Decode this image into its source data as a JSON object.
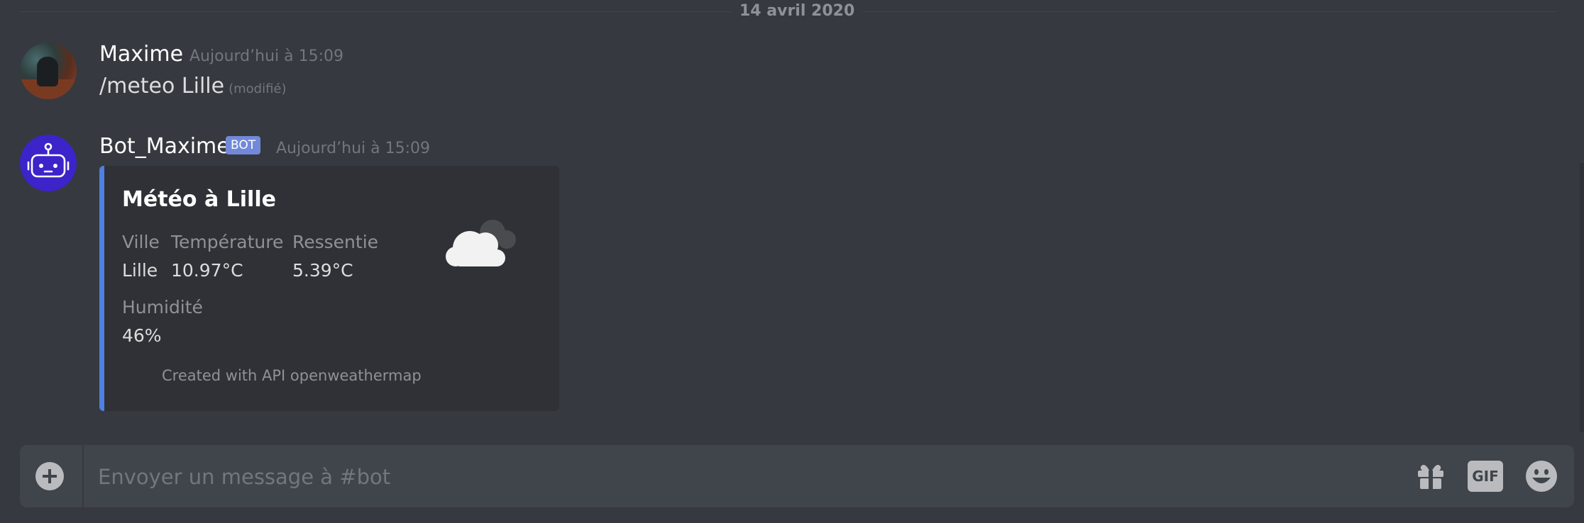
{
  "divider": {
    "date": "14 avril 2020"
  },
  "messages": [
    {
      "author": "Maxime",
      "timestamp": "Aujourd’hui à 15:09",
      "text": "/meteo Lille",
      "edited": "(modifié)"
    },
    {
      "author": "Bot_Maxime",
      "badge": "BOT",
      "timestamp": "Aujourd’hui à 15:09",
      "embed": {
        "accent_color": "#4f80e1",
        "title": "Météo à Lille",
        "fields": [
          {
            "name": "Ville",
            "value": "Lille"
          },
          {
            "name": "Température",
            "value": "10.97°C"
          },
          {
            "name": "Ressentie",
            "value": "5.39°C"
          },
          {
            "name": "Humidité",
            "value": "46%"
          }
        ],
        "footer": "Created with API openweathermap",
        "thumbnail_icon": "cloud-icon"
      }
    }
  ],
  "composer": {
    "placeholder": "Envoyer un message à #bot",
    "buttons": {
      "attach_icon": "plus-circle-icon",
      "gift_icon": "gift-icon",
      "gif_label": "GIF",
      "emoji_icon": "emoji-icon"
    }
  },
  "colors": {
    "background": "#36393f",
    "embed_background": "#2f3136",
    "bot_badge": "#7289da",
    "bot_avatar": "#3b24c9"
  }
}
